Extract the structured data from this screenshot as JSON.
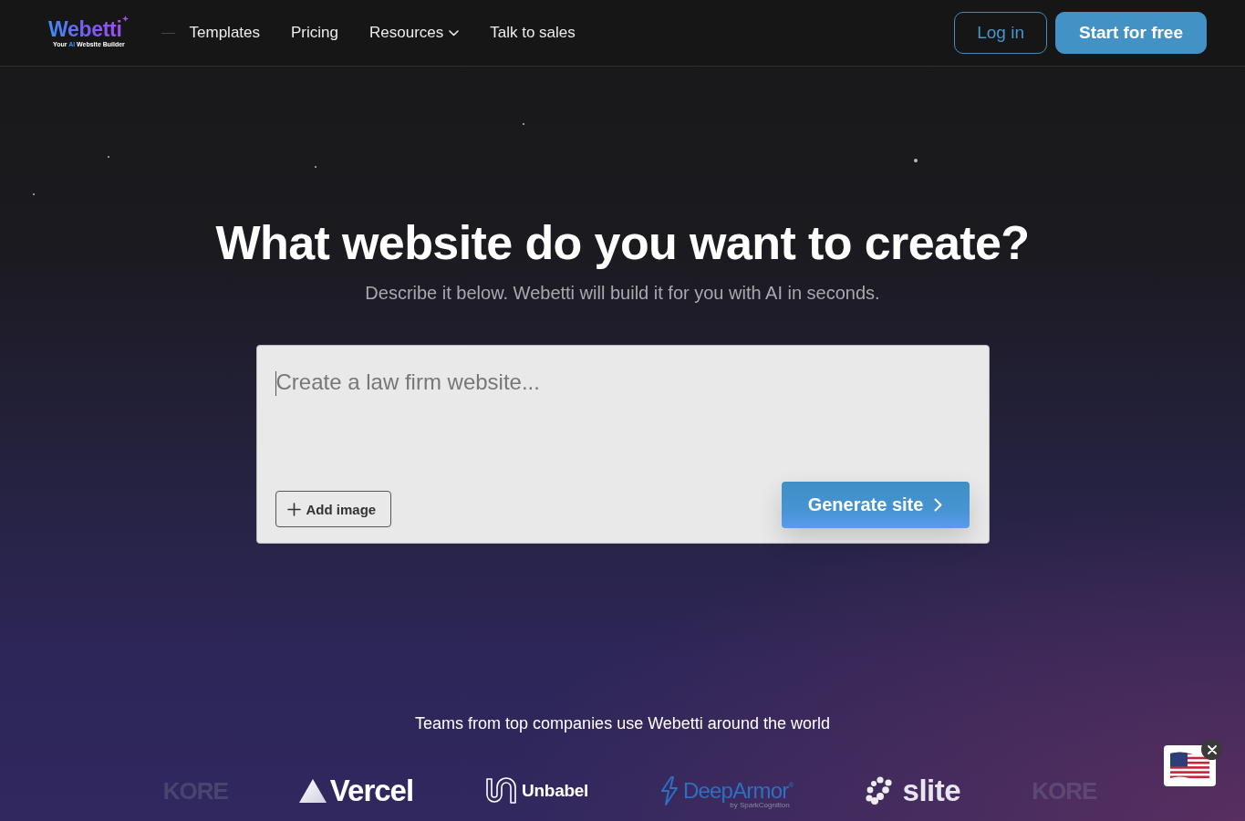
{
  "header": {
    "logo": {
      "name": "Webetti",
      "tagline": [
        {
          "text": "Your",
          "highlight": false
        },
        {
          "text": "AI",
          "highlight": true
        },
        {
          "text": "Website Builder",
          "highlight": false
        }
      ]
    },
    "nav": [
      {
        "label": "Templates",
        "dropdown": false
      },
      {
        "label": "Pricing",
        "dropdown": false
      },
      {
        "label": "Resources",
        "dropdown": true
      },
      {
        "label": "Talk to sales",
        "dropdown": false
      }
    ],
    "actions": [
      {
        "label": "Log in",
        "kind": "outline"
      },
      {
        "label": "Start for free",
        "kind": "filled"
      }
    ]
  },
  "hero": {
    "title": "What website do you want to create?",
    "subtitle": "Describe it below. Webetti will build it for you with AI in seconds."
  },
  "prompt": {
    "placeholder": "Create a law firm website...",
    "add_image": "Add image",
    "generate": "Generate site"
  },
  "companies": {
    "caption": "Teams from top companies use Webetti around the world",
    "logos": [
      {
        "kind": "kore",
        "name": "KORE",
        "faded": true
      },
      {
        "kind": "vercel",
        "name": "Vercel",
        "faded": false
      },
      {
        "kind": "unbabel",
        "name": "Unbabel",
        "faded": false
      },
      {
        "kind": "deeparmor",
        "name": "DeepArmor$^{®}$",
        "byline": "by SparkCognition",
        "faded": false
      },
      {
        "kind": "slite",
        "name": "slite",
        "faded": false
      },
      {
        "kind": "kore",
        "name": "KORE",
        "faded": true
      }
    ]
  }
}
